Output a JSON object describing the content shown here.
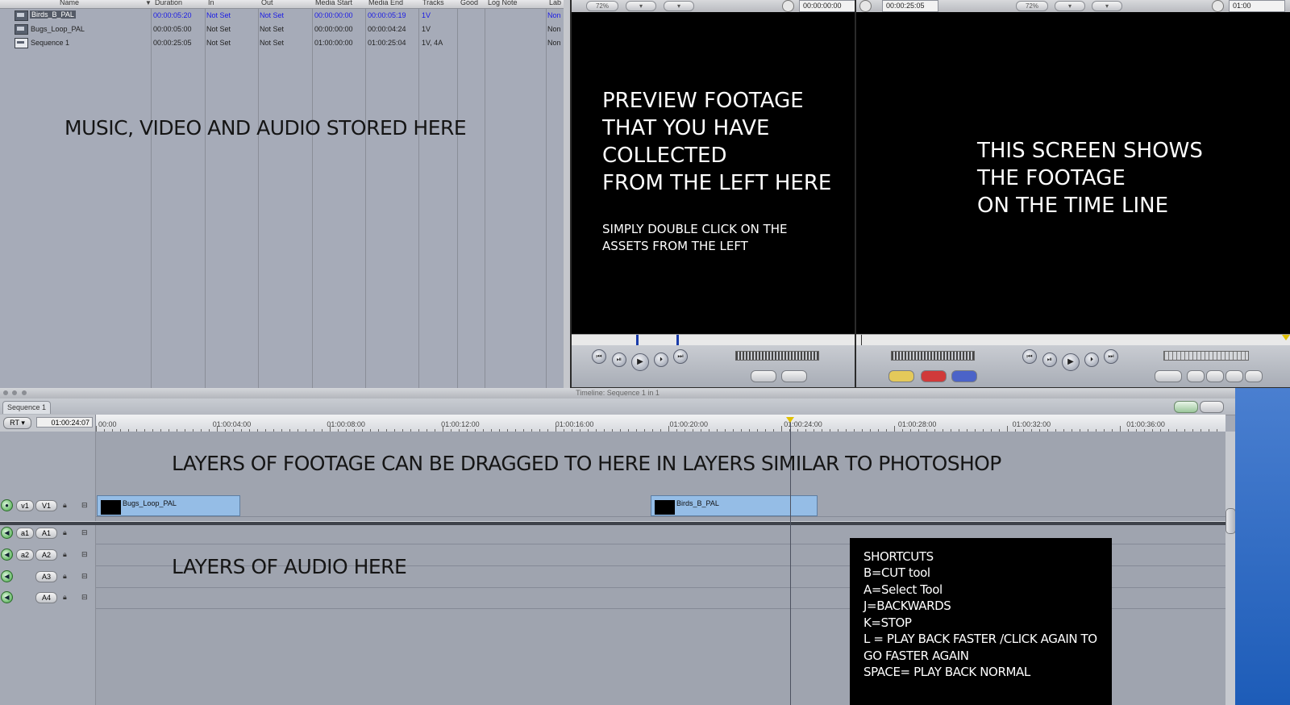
{
  "browser": {
    "columns": [
      "Name",
      "Duration",
      "In",
      "Out",
      "Media Start",
      "Media End",
      "Tracks",
      "Good",
      "Log Note",
      "Lab"
    ],
    "rows": [
      {
        "name": "Birds_B_PAL",
        "duration": "00:00:05:20",
        "in": "Not Set",
        "out": "Not Set",
        "media_start": "00:00:00:00",
        "media_end": "00:00:05:19",
        "tracks": "1V",
        "label": "Non"
      },
      {
        "name": "Bugs_Loop_PAL",
        "duration": "00:00:05:00",
        "in": "Not Set",
        "out": "Not Set",
        "media_start": "00:00:00:00",
        "media_end": "00:00:04:24",
        "tracks": "1V",
        "label": "Non"
      },
      {
        "name": "Sequence 1",
        "duration": "00:00:25:05",
        "in": "Not Set",
        "out": "Not Set",
        "media_start": "01:00:00:00",
        "media_end": "01:00:25:04",
        "tracks": "1V, 4A",
        "label": "Non"
      }
    ],
    "note": "MUSIC, VIDEO AND AUDIO STORED HERE"
  },
  "viewer": {
    "zoom": "72%",
    "timecode": "00:00:00:00",
    "note_lines": "PREVIEW FOOTAGE\nTHAT YOU HAVE\nCOLLECTED\nFROM THE LEFT HERE",
    "sub_note": "SIMPLY DOUBLE CLICK ON THE\nASSETS FROM THE LEFT"
  },
  "canvas": {
    "duration_tc": "00:00:25:05",
    "zoom": "72%",
    "timecode": "01:00",
    "note_lines": "THIS SCREEN SHOWS\nTHE FOOTAGE\nON THE TIME LINE"
  },
  "timeline": {
    "title": "Timeline: Sequence 1 in 1",
    "tab": "Sequence 1",
    "rt_label": "RT",
    "current_tc": "01:00:24:07",
    "ruler_labels": [
      "00:00",
      "01:00:04:00",
      "01:00:08:00",
      "01:00:12:00",
      "01:00:16:00",
      "01:00:20:00",
      "01:00:24:00",
      "01:00:28:00",
      "01:00:32:00",
      "01:00:36:00"
    ],
    "tracks": [
      {
        "src": "v1",
        "dst": "V1"
      },
      {
        "src": "a1",
        "dst": "A1"
      },
      {
        "src": "a2",
        "dst": "A2"
      },
      {
        "src": "",
        "dst": "A3"
      },
      {
        "src": "",
        "dst": "A4"
      }
    ],
    "clips": [
      {
        "name": "Bugs_Loop_PAL"
      },
      {
        "name": "Birds_B_PAL"
      }
    ],
    "note_video": "LAYERS OF FOOTAGE CAN BE DRAGGED TO HERE IN LAYERS SIMILAR TO PHOTOSHOP",
    "note_audio": "LAYERS OF AUDIO HERE"
  },
  "shortcuts": {
    "lines": [
      "SHORTCUTS",
      "B=CUT tool",
      "A=Select Tool",
      "J=BACKWARDS",
      "K=STOP",
      "L   = PLAY BACK FASTER /CLICK AGAIN TO",
      "GO  FASTER AGAIN",
      "SPACE= PLAY BACK NORMAL"
    ]
  },
  "icons": [
    "clip-icon",
    "sequence-icon",
    "play-icon",
    "rewind-icon",
    "fast-forward-icon",
    "lock-icon",
    "link-icon",
    "speaker-icon",
    "eye-icon",
    "clock-icon"
  ],
  "colors": {
    "clip_fill": "#95bde6",
    "playhead": "#e0c000",
    "overlay_bg": "#000000",
    "timecode_blue": "#1a1ae6"
  }
}
